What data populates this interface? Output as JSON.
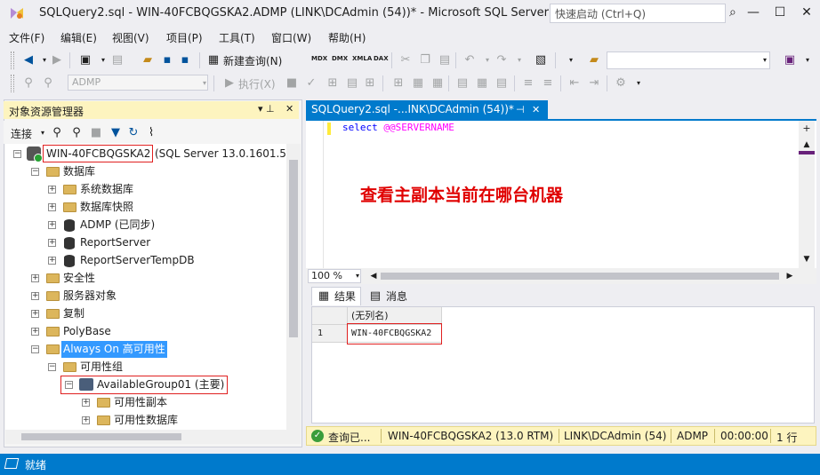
{
  "window": {
    "title": "SQLQuery2.sql - WIN-40FCBQGSKA2.ADMP (LINK\\DCAdmin (54))* - Microsoft SQL Server Mana...",
    "quick_launch_placeholder": "快速启动 (Ctrl+Q)",
    "minimize": "—",
    "restore": "☐",
    "close": "✕"
  },
  "menu": [
    "文件(F)",
    "编辑(E)",
    "视图(V)",
    "项目(P)",
    "工具(T)",
    "窗口(W)",
    "帮助(H)"
  ],
  "toolbar": {
    "new_query": "新建查询(N)",
    "mdx": "MDX",
    "dmx": "DMX",
    "xmla": "XMLA",
    "dax": "DAX",
    "database_selector": "ADMP",
    "execute": "执行(X)"
  },
  "object_explorer": {
    "title": "对象资源管理器",
    "connect": "连接",
    "pin_icon": "▾ ⊥",
    "close": "✕",
    "server_name": "WIN-40FCBQGSKA2",
    "server_info": "(SQL Server 13.0.1601.5 -",
    "nodes": {
      "databases": "数据库",
      "system_dbs": "系统数据库",
      "db_snapshots": "数据库快照",
      "admp": "ADMP (已同步)",
      "report_server": "ReportServer",
      "report_server_temp": "ReportServerTempDB",
      "security": "安全性",
      "server_objects": "服务器对象",
      "replication": "复制",
      "polybase": "PolyBase",
      "always_on": "Always On 高可用性",
      "availability_groups": "可用性组",
      "ag01": "AvailableGroup01 (主要)",
      "ag_replicas": "可用性副本",
      "ag_databases": "可用性数据库"
    }
  },
  "editor": {
    "tab_label": "SQLQuery2.sql -...INK\\DCAdmin (54))*",
    "tab_pin": "⊣",
    "tab_close": "✕",
    "code_keyword": "select",
    "code_var": "@@SERVERNAME",
    "annotation": "查看主副本当前在哪台机器",
    "zoom": "100 %"
  },
  "results": {
    "tab_results": "结果",
    "tab_messages": "消息",
    "column_header": "(无列名)",
    "rows": [
      {
        "num": "1",
        "value": "WIN-40FCBQGSKA2"
      }
    ]
  },
  "query_status": {
    "state": "查询已...",
    "server": "WIN-40FCBQGSKA2 (13.0 RTM)",
    "user": "LINK\\DCAdmin (54)",
    "db": "ADMP",
    "time": "00:00:00",
    "rows": "1 行"
  },
  "status_bar": {
    "text": "就绪"
  },
  "colors": {
    "accent": "#007acc",
    "highlight": "#fdf4bf",
    "annotation": "#e00000"
  }
}
